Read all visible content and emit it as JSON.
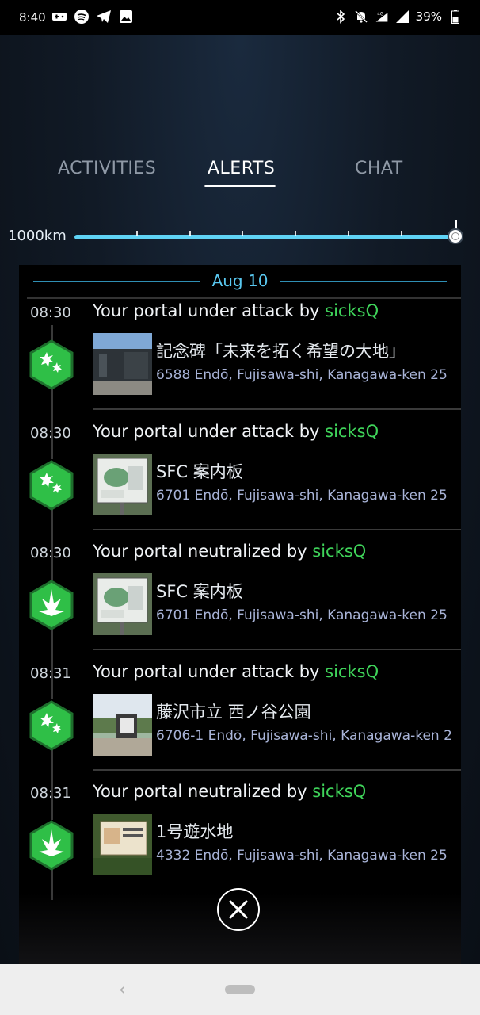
{
  "status_bar": {
    "time": "8:40",
    "battery": "39%",
    "left_icons": [
      "gamepad-icon",
      "spotify-icon",
      "telegram-icon",
      "image-icon"
    ],
    "right_icons": [
      "bluetooth-icon",
      "mute-icon",
      "signal-4g-icon",
      "signal-icon",
      "battery-icon"
    ],
    "network": "4G"
  },
  "tabs": [
    {
      "label": "ACTIVITIES",
      "active": false
    },
    {
      "label": "ALERTS",
      "active": true
    },
    {
      "label": "CHAT",
      "active": false
    }
  ],
  "range": {
    "label": "1000km",
    "value_fraction": 1.0
  },
  "date_header": "Aug 10",
  "alerts": [
    {
      "time": "08:30",
      "message": "Your portal under attack by ",
      "agent": "sicksQ",
      "type": "attack",
      "portal_name": "記念碑「未来を拓く希望の大地」",
      "portal_address": "6588 Endō, Fujisawa-shi, Kanagawa-ken 25",
      "thumb": "building"
    },
    {
      "time": "08:30",
      "message": "Your portal under attack by ",
      "agent": "sicksQ",
      "type": "attack",
      "portal_name": "SFC 案内板",
      "portal_address": "6701 Endō, Fujisawa-shi, Kanagawa-ken 25",
      "thumb": "map-board"
    },
    {
      "time": "08:30",
      "message": "Your portal neutralized by ",
      "agent": "sicksQ",
      "type": "neutralized",
      "portal_name": "SFC 案内板",
      "portal_address": "6701 Endō, Fujisawa-shi, Kanagawa-ken 25",
      "thumb": "map-board"
    },
    {
      "time": "08:31",
      "message": "Your portal under attack by ",
      "agent": "sicksQ",
      "type": "attack",
      "portal_name": "藤沢市立 西ノ谷公園",
      "portal_address": "6706-1 Endō, Fujisawa-shi, Kanagawa-ken 2",
      "thumb": "park-sign"
    },
    {
      "time": "08:31",
      "message": "Your portal neutralized by ",
      "agent": "sicksQ",
      "type": "neutralized",
      "portal_name": "1号遊水地",
      "portal_address": "4332 Endō, Fujisawa-shi, Kanagawa-ken 25",
      "thumb": "sign-board"
    }
  ],
  "colors": {
    "agent": "#3fd45a",
    "accent": "#59c7ef",
    "hex_fill": "#2fbf47",
    "hex_border": "#1e6f2d"
  },
  "nav": {
    "back_icon": "back-chevron-icon",
    "home_icon": "home-pill-icon"
  }
}
